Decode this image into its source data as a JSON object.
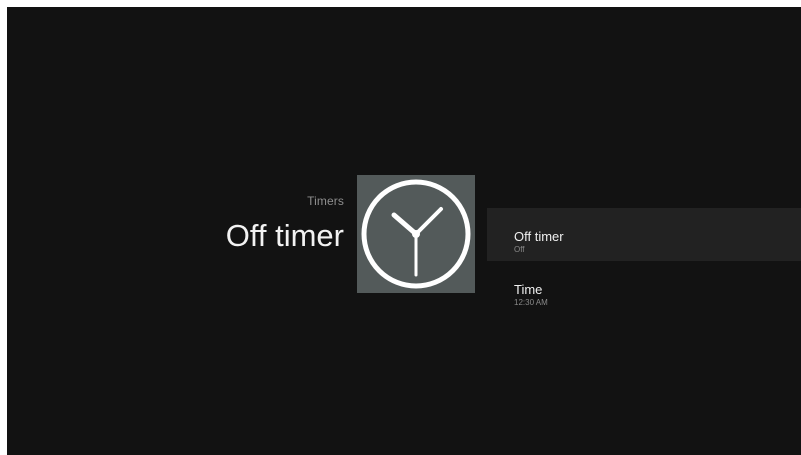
{
  "header": {
    "category": "Timers",
    "title": "Off timer"
  },
  "tile": {
    "icon": "clock-icon",
    "background_color": "#535a5a",
    "icon_color": "#ffffff"
  },
  "menu": {
    "items": [
      {
        "label": "Off timer",
        "value": "Off",
        "selected": true
      },
      {
        "label": "Time",
        "value": "12:30 AM",
        "selected": false
      }
    ]
  },
  "colors": {
    "background": "#121212",
    "selected_row": "#222222",
    "primary_text": "#f0f0f0",
    "secondary_text": "#8a8a8a"
  }
}
